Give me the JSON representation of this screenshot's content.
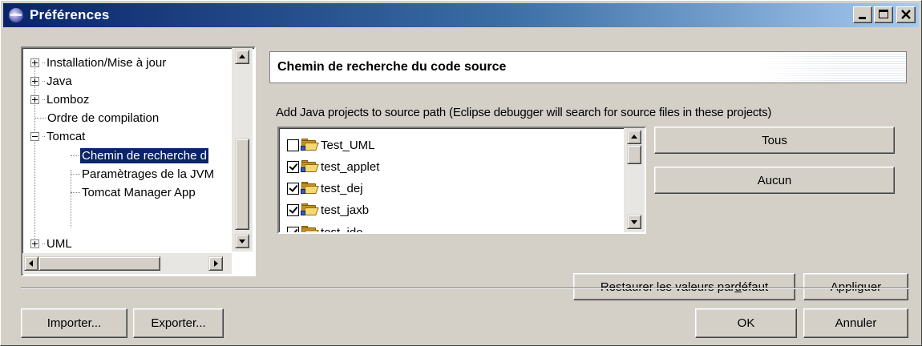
{
  "window": {
    "title": "Préférences",
    "icon": "eclipse-icon",
    "controls": [
      "minimize-icon",
      "maximize-icon",
      "close-icon"
    ]
  },
  "tree": {
    "items": [
      {
        "label": "Installation/Mise à jour",
        "expander": "plus",
        "level": 0
      },
      {
        "label": "Java",
        "expander": "plus",
        "level": 0
      },
      {
        "label": "Lomboz",
        "expander": "plus",
        "level": 0
      },
      {
        "label": "Ordre de compilation",
        "expander": "none",
        "level": 0
      },
      {
        "label": "Tomcat",
        "expander": "minus",
        "level": 0
      },
      {
        "label": "Chemin de recherche d",
        "expander": "none",
        "level": 1,
        "selected": true
      },
      {
        "label": "Paramètrages de la JVM",
        "expander": "none",
        "level": 1
      },
      {
        "label": "Tomcat Manager App",
        "expander": "none",
        "level": 1
      },
      {
        "label": "UML",
        "expander": "plus",
        "level": 0
      }
    ]
  },
  "page": {
    "title": "Chemin de recherche du code source",
    "description": "Add Java projects to source path (Eclipse debugger will search for source files in these projects)",
    "projects": [
      {
        "name": "Test_UML",
        "checked": false
      },
      {
        "name": "test_applet",
        "checked": true
      },
      {
        "name": "test_dej",
        "checked": true
      },
      {
        "name": "test_jaxb",
        "checked": true
      },
      {
        "name": "test_jdo",
        "checked": true
      }
    ],
    "buttons": {
      "all": "Tous",
      "none": "Aucun",
      "restore_prefix": "Restaurer les valeurs par ",
      "restore_ul": "d",
      "restore_suffix": "éfaut",
      "apply_prefix": "Appli",
      "apply_ul": "g",
      "apply_suffix": "uer"
    }
  },
  "footer": {
    "import": "Importer...",
    "export": "Exporter...",
    "ok": "OK",
    "cancel": "Annuler"
  },
  "colors": {
    "title_start": "#0a246a",
    "title_end": "#a6caf0",
    "selection": "#0a246a",
    "face": "#d4d0c8"
  }
}
